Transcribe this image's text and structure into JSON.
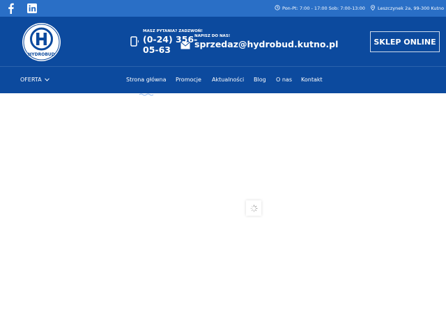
{
  "colors": {
    "topbar": "#2a6fc6",
    "header": "#0c4a9e",
    "text": "#ffffff"
  },
  "topbar": {
    "icons": [
      "facebook-icon",
      "linkedin-icon",
      "clock-icon",
      "location-pin-icon"
    ],
    "hours": "Pon-Pt: 7:00 - 17:00 Sob: 7:00-13:00",
    "address": "Leszczynek 2a, 99-300 Kutno"
  },
  "logo": {
    "text": "HYDROBUD",
    "letter": "H"
  },
  "contact": {
    "phone_label": "MASZ PYTANIA? ZADZWOŃ!",
    "phone_value": "(0-24) 356-05-63",
    "mail_label": "NAPISZ DO NAS!",
    "mail_value": "sprzedaz@hydrobud.kutno.pl"
  },
  "shop_button": "SKLEP ONLINE",
  "nav": {
    "oferta": "OFERTA",
    "items": [
      "Strona główna",
      "Promocje",
      "Aktualności",
      "Blog",
      "O nas",
      "Kontakt"
    ],
    "active": "Strona główna"
  },
  "loader": {
    "icon": "loading-spinner-icon"
  }
}
